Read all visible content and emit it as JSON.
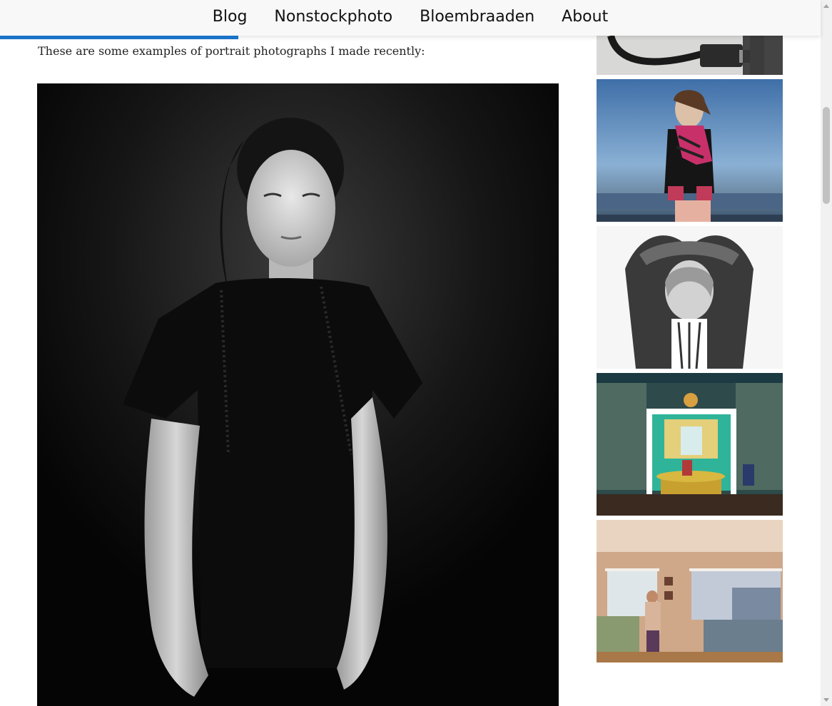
{
  "nav": {
    "items": [
      {
        "label": "Blog"
      },
      {
        "label": "Nonstockphoto"
      },
      {
        "label": "Bloembraaden"
      },
      {
        "label": "About"
      }
    ]
  },
  "reading_progress": 0.29,
  "colors": {
    "accent": "#1a73c8",
    "nav_background": "#f8f8f8",
    "text": "#222222"
  },
  "content": {
    "intro": "These are some examples of portrait photographs I made recently:"
  }
}
